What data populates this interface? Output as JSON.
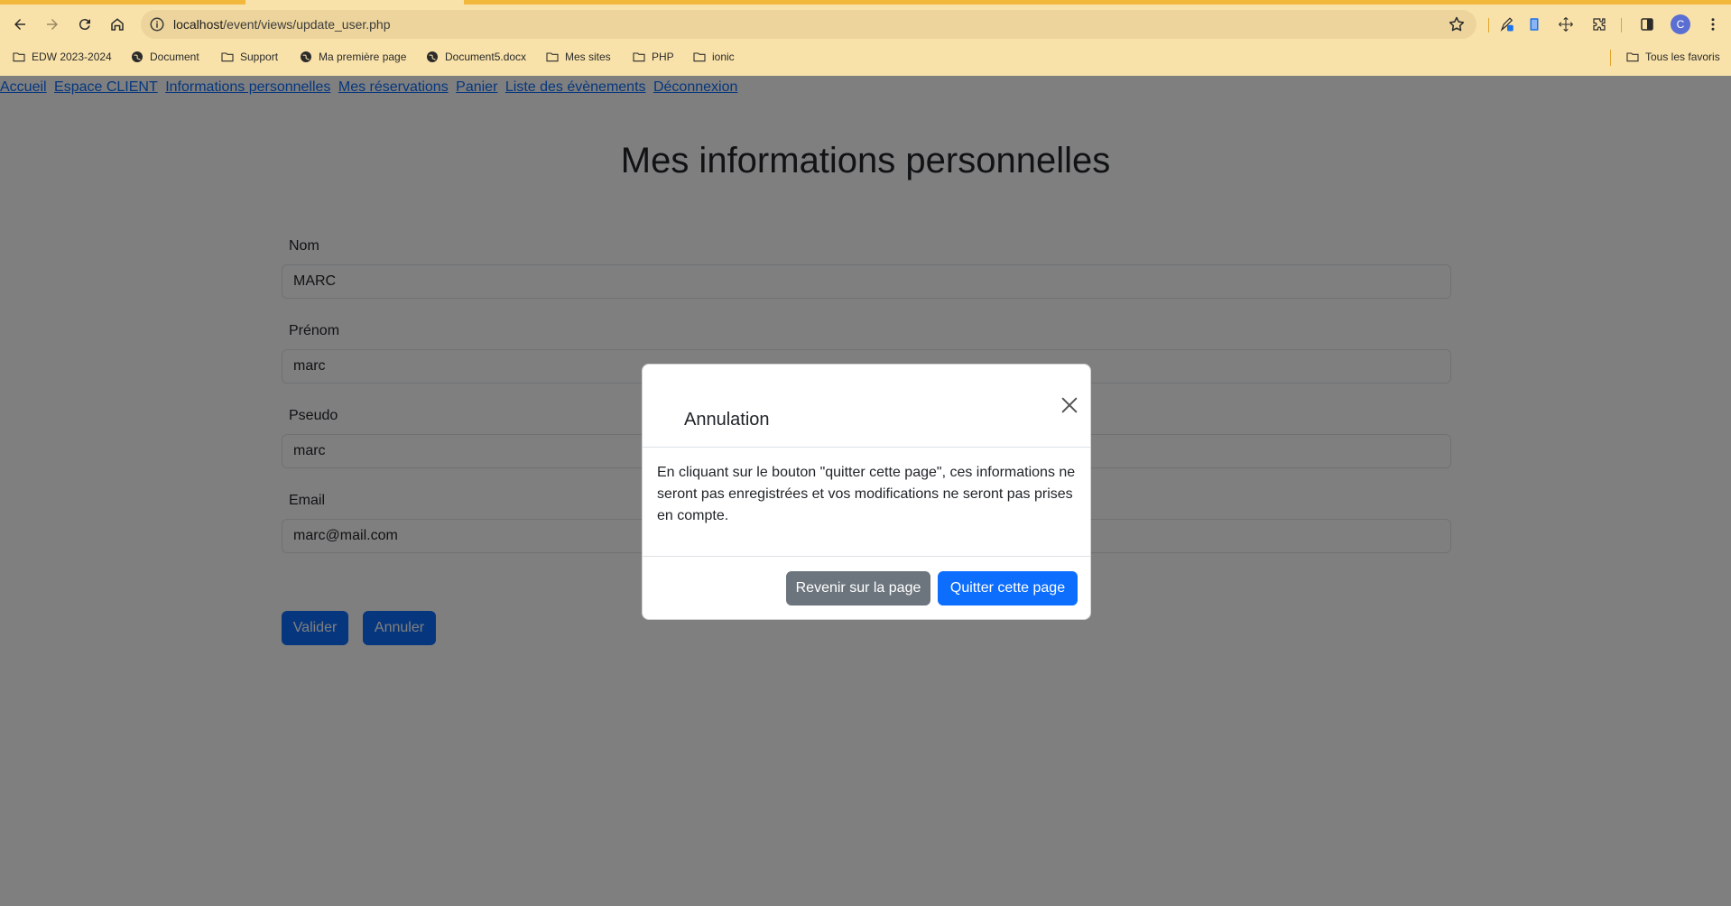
{
  "browser": {
    "url_host": "localhost",
    "url_path": "/event/views/update_user.php",
    "avatar_letter": "C",
    "bookmarks": [
      {
        "label": "EDW 2023-2024",
        "icon": "folder-icon"
      },
      {
        "label": "Document",
        "icon": "globe-icon"
      },
      {
        "label": "Support",
        "icon": "folder-icon"
      },
      {
        "label": "Ma première page",
        "icon": "globe-icon"
      },
      {
        "label": "Document5.docx",
        "icon": "globe-icon"
      },
      {
        "label": "Mes sites",
        "icon": "folder-icon"
      },
      {
        "label": "PHP",
        "icon": "folder-icon"
      },
      {
        "label": "ionic",
        "icon": "folder-icon"
      }
    ],
    "all_bookmarks_label": "Tous les favoris"
  },
  "nav": {
    "links": [
      "Accueil",
      "Espace CLIENT",
      "Informations personnelles",
      "Mes réservations",
      "Panier",
      "Liste des évènements",
      "Déconnexion"
    ]
  },
  "page": {
    "title": "Mes informations personnelles",
    "fields": [
      {
        "label": "Nom",
        "value": "MARC"
      },
      {
        "label": "Prénom",
        "value": "marc"
      },
      {
        "label": "Pseudo",
        "value": "marc"
      },
      {
        "label": "Email",
        "value": "marc@mail.com"
      }
    ],
    "submit_label": "Valider",
    "cancel_label": "Annuler"
  },
  "modal": {
    "title": "Annulation",
    "body": "En cliquant sur le bouton \"quitter cette page\", ces informations ne seront pas enregistrées et vos modifications ne seront pas prises en compte.",
    "back_label": "Revenir sur la page",
    "quit_label": "Quitter cette page"
  },
  "colors": {
    "chrome_bg": "#f9e2a9",
    "link": "#0d6efd",
    "primary": "#0d6efd",
    "secondary": "#6c757d"
  }
}
